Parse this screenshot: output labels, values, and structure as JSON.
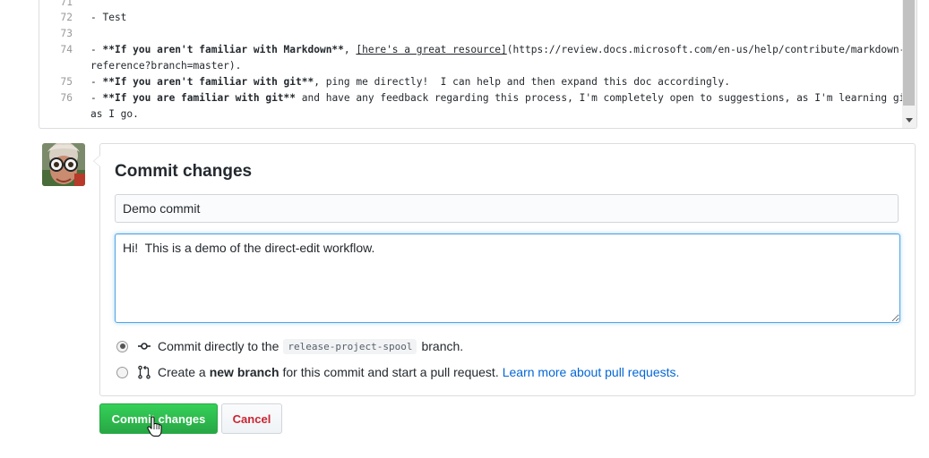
{
  "editor": {
    "lines": [
      {
        "num": "71",
        "parts": []
      },
      {
        "num": "72",
        "parts": [
          {
            "t": "- Test",
            "s": "n"
          }
        ]
      },
      {
        "num": "73",
        "parts": []
      },
      {
        "num": "74",
        "parts": [
          {
            "t": "- ",
            "s": "n"
          },
          {
            "t": "**If you aren't familiar with Markdown**",
            "s": "b"
          },
          {
            "t": ", ",
            "s": "n"
          },
          {
            "t": "[here's a great resource]",
            "s": "u"
          },
          {
            "t": "(https://review.docs.microsoft.com/en-us/help/contribute/markdown-",
            "s": "n"
          }
        ]
      },
      {
        "num": "",
        "parts": [
          {
            "t": "reference?branch=master).",
            "s": "n"
          }
        ]
      },
      {
        "num": "75",
        "parts": [
          {
            "t": "- ",
            "s": "n"
          },
          {
            "t": "**If you aren't familiar with git**",
            "s": "b"
          },
          {
            "t": ", ping me directly!  I can help and then expand this doc accordingly.",
            "s": "n"
          }
        ]
      },
      {
        "num": "76",
        "parts": [
          {
            "t": "- ",
            "s": "n"
          },
          {
            "t": "**If you are familiar with git**",
            "s": "b"
          },
          {
            "t": " and have any feedback regarding this process, I'm completely open to suggestions, as I'm learning git",
            "s": "n"
          }
        ]
      },
      {
        "num": "",
        "parts": [
          {
            "t": "as I go.",
            "s": "n"
          }
        ]
      }
    ]
  },
  "commit": {
    "title": "Commit changes",
    "summary_value": "Demo commit",
    "description_value": "Hi!  This is a demo of the direct-edit workflow.",
    "option_direct": {
      "prefix": "Commit directly to the",
      "branch": "release-project-spool",
      "suffix": "branch."
    },
    "option_new": {
      "prefix": "Create a",
      "bold": "new branch",
      "suffix": "for this commit and start a pull request.",
      "link": "Learn more about pull requests."
    },
    "commit_button": "Commit changes",
    "cancel_button": "Cancel"
  },
  "colors": {
    "primary_green": "#28a745",
    "cancel_red": "#cb2431",
    "link_blue": "#0366d6",
    "focus_blue": "#51a7e8"
  },
  "icons": {
    "commit_option": "git-commit-icon",
    "new_branch_option": "git-pull-request-icon"
  }
}
